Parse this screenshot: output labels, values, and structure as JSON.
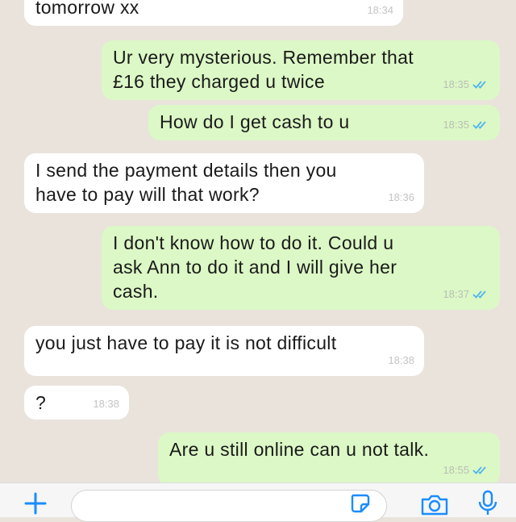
{
  "messages": [
    {
      "text": "tomorrow xx",
      "time": "18:34",
      "direction": "incoming"
    },
    {
      "text": "Ur very mysterious. Remember that\n£16 they charged u twice",
      "time": "18:35",
      "direction": "outgoing",
      "status": "read"
    },
    {
      "text": "How do I get cash to u",
      "time": "18:35",
      "direction": "outgoing",
      "status": "read"
    },
    {
      "text": "I send the payment details then you\nhave to pay will that work?",
      "time": "18:36",
      "direction": "incoming"
    },
    {
      "text": "I don't know how to do it. Could u\nask Ann to do it and I will give her\ncash.",
      "time": "18:37",
      "direction": "outgoing",
      "status": "read"
    },
    {
      "text": "you just have to pay it is not difficult",
      "time": "18:38",
      "direction": "incoming"
    },
    {
      "text": "?",
      "time": "18:38",
      "direction": "incoming"
    },
    {
      "text": "Are u still online can u not talk.",
      "time": "18:55",
      "direction": "outgoing",
      "status": "read"
    }
  ],
  "input_bar": {
    "message_placeholder": "",
    "icons": [
      "plus-icon",
      "sticker-icon",
      "camera-icon",
      "microphone-icon"
    ]
  },
  "colors": {
    "chat_background": "#e9e3dc",
    "incoming_bubble": "#ffffff",
    "outgoing_bubble": "#dcf8c6",
    "read_ticks": "#4fb6ec",
    "accent_blue": "#1a8cff"
  }
}
